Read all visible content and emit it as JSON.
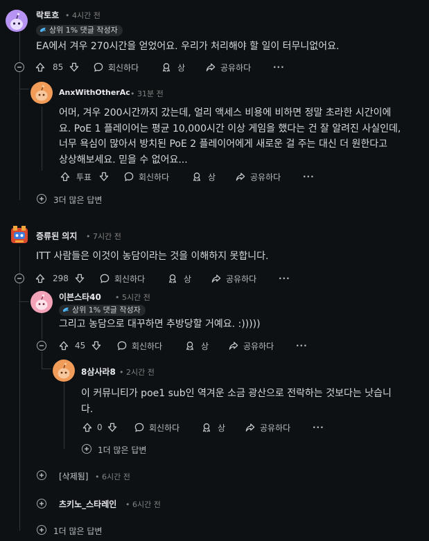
{
  "colors": {
    "background": "#0e1113",
    "thread_line": "#343638",
    "text": "#d7dadc",
    "meta": "#818384"
  },
  "comments": [
    {
      "author": "락토흐",
      "time": "• 4시간 전",
      "badge": "상위 1% 댓글 작성자",
      "body": [
        "EA에서 겨우 270시간을 얻었어요. 우리가 처리해야 할 일이 터무니없어요."
      ],
      "votes": "85",
      "reply": "회신하다",
      "award": "상",
      "share": "공유하다",
      "avatar_icon": "snoo-purple-avatar"
    },
    {
      "author": "AnxWithOtherAc",
      "time": "• 31분 전",
      "body": [
        "어머, 겨우 200시간까지 갔는데, 얼리 액세스 비용에 비하면 정말 초라한 시간이에",
        "요. PoE 1 플레이어는 평균 10,000시간 이상 게임을 했다는 건 잘 알려진 사실인데,",
        "너무 욕심이 많아서 방치된 PoE 2 플레이어에게 새로운 걸 주는 대신 더 원한다고",
        "상상해보세요. 믿을 수 없어요..."
      ],
      "votes": "투표",
      "reply": "회신하다",
      "award": "상",
      "share": "공유하다",
      "avatar_icon": "snoo-orange-avatar"
    },
    {
      "author": "증류된 의지",
      "time": "• 7시간 전",
      "body": [
        "ITT 사람들은 이것이 농담이라는 것을 이해하지 못합니다."
      ],
      "votes": "298",
      "reply": "회신하다",
      "award": "상",
      "share": "공유하다",
      "avatar_icon": "mascot-avatar"
    },
    {
      "author": "이븐스타40",
      "time": "• 5시간 전",
      "badge": "상위 1% 댓글 작성자",
      "body": [
        "그리고 농담으로 대꾸하면 추방당할 거예요. :)))))"
      ],
      "votes": "45",
      "reply": "회신하다",
      "award": "상",
      "share": "공유하다",
      "avatar_icon": "snoo-pink-avatar"
    },
    {
      "author": "8삼사라8",
      "time": "• 2시간 전",
      "body": [
        "이 커뮤니티가 poe1 sub인 역겨운 소금 광산으로 전락하는 것보다는 낫습니",
        "다."
      ],
      "votes": "0",
      "reply": "회신하다",
      "award": "상",
      "share": "공유하다",
      "avatar_icon": "snoo-orange-avatar"
    }
  ],
  "more_replies": {
    "first": "3더 많은 답변",
    "nested": "1더 많은 답변",
    "last": "1더 많은 답변"
  },
  "collapsed": [
    {
      "author": "[삭제됨]",
      "time": "• 6시간 전"
    },
    {
      "author": "츠키노_스타레인",
      "time": "• 6시간 전"
    }
  ],
  "icons": [
    "upvote-icon",
    "downvote-icon",
    "reply-bubble-icon",
    "award-icon",
    "share-arrow-icon",
    "more-options-icon",
    "collapse-minus-icon",
    "expand-plus-icon"
  ]
}
